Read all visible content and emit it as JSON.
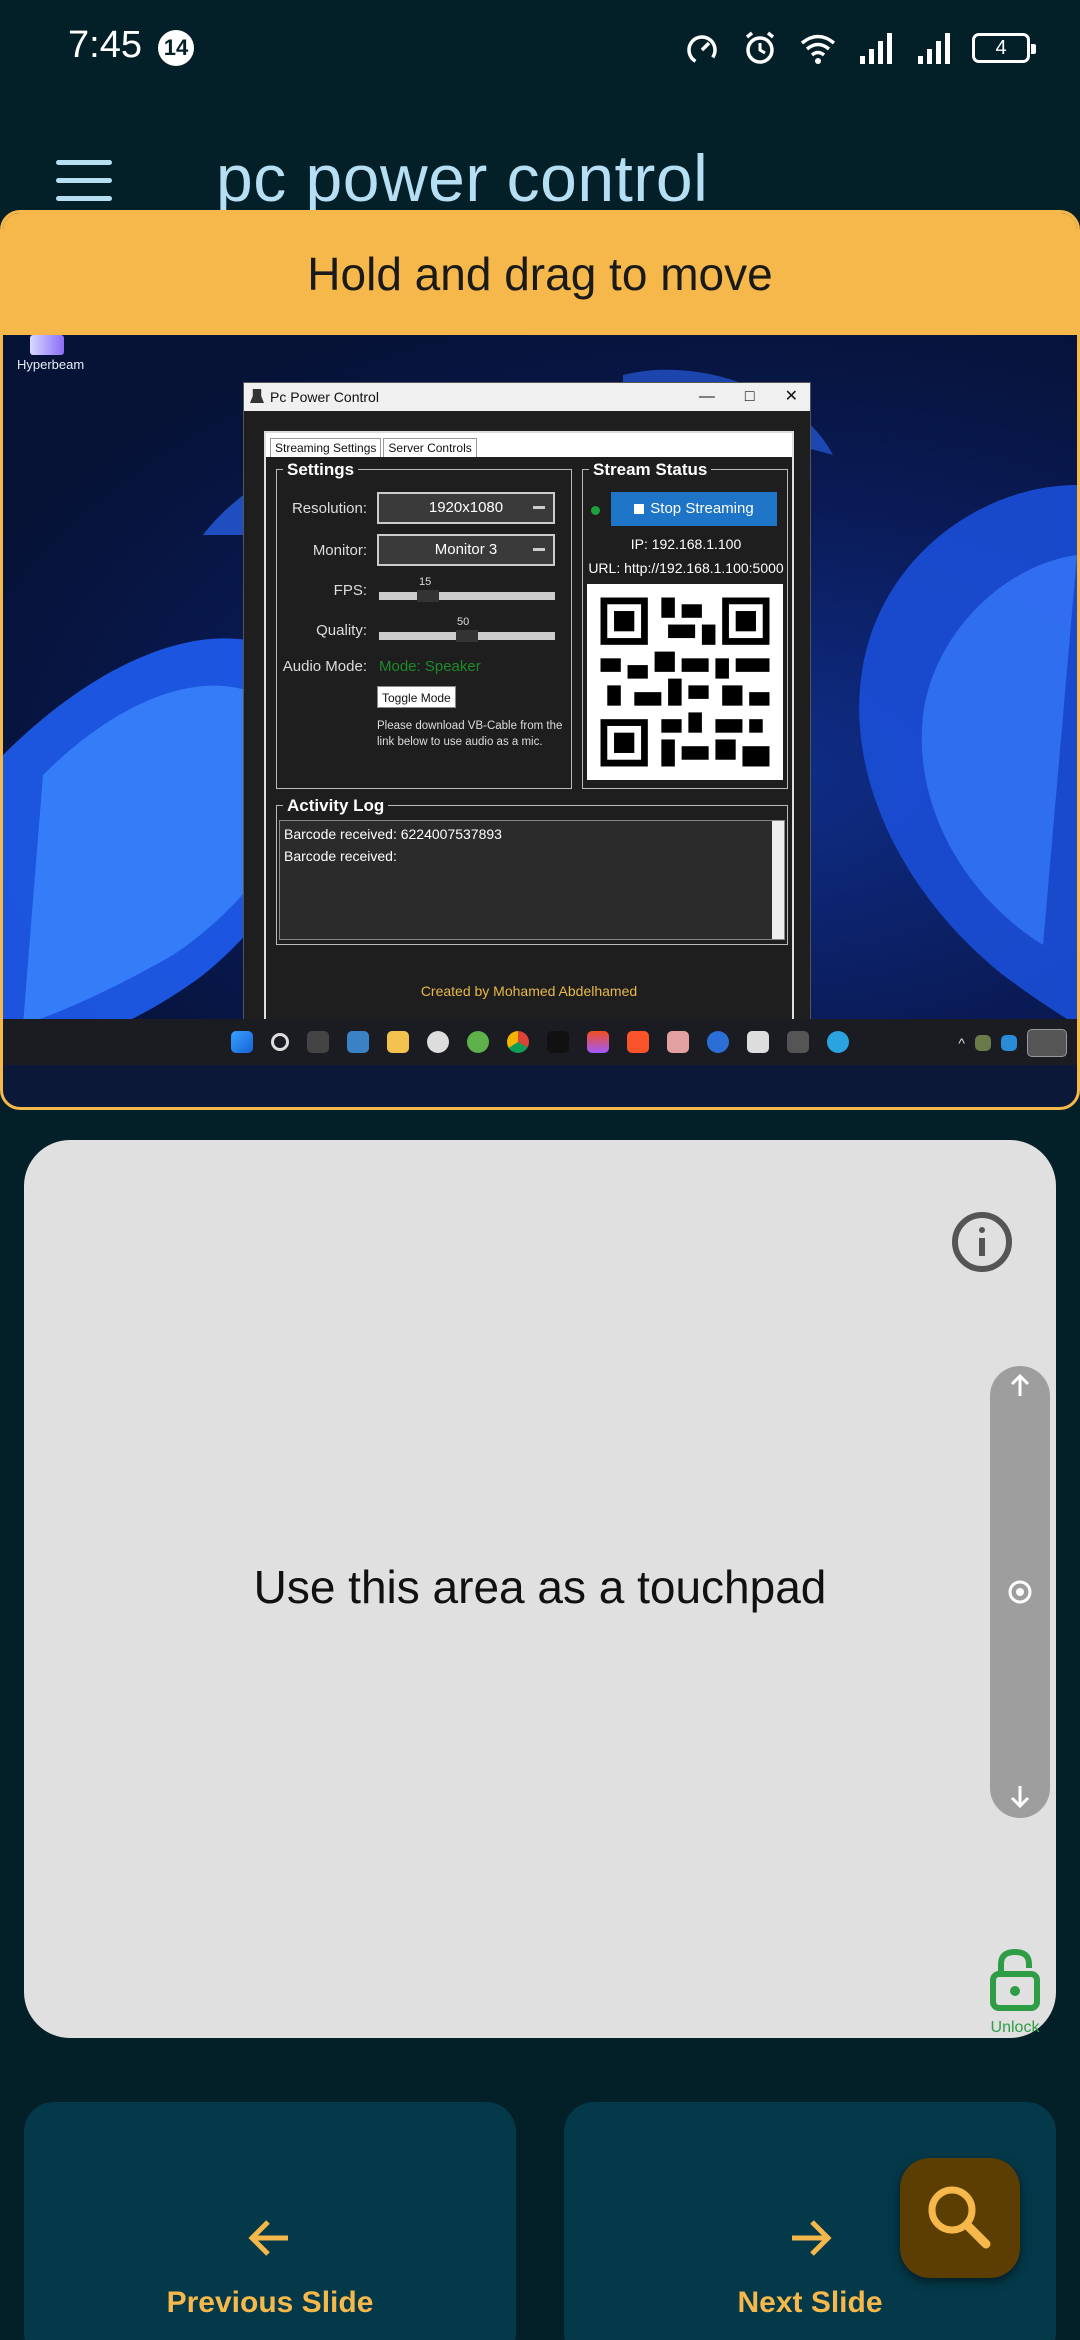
{
  "status_bar": {
    "time": "7:45",
    "notification_count": "14",
    "battery": "4"
  },
  "app_bar": {
    "title": "pc power control"
  },
  "stream": {
    "drag_hint": "Hold and drag to move",
    "desktop_icon_label": "Hyperbeam",
    "window": {
      "title": "Pc Power Control",
      "tabs": [
        "Streaming Settings",
        "Server Controls"
      ],
      "settings": {
        "group_title": "Settings",
        "resolution_label": "Resolution:",
        "resolution_value": "1920x1080",
        "monitor_label": "Monitor:",
        "monitor_value": "Monitor 3",
        "fps_label": "FPS:",
        "fps_value": "15",
        "quality_label": "Quality:",
        "quality_value": "50",
        "audio_mode_label": "Audio Mode:",
        "audio_mode_value": "Mode: Speaker",
        "toggle_mode_button": "Toggle Mode",
        "note_line1": "Please download VB-Cable from the",
        "note_line2": "link below to use audio as a mic."
      },
      "stream_status": {
        "group_title": "Stream Status",
        "stop_button": "Stop Streaming",
        "ip": "IP: 192.168.1.100",
        "url": "URL: http://192.168.1.100:5000"
      },
      "activity_log": {
        "group_title": "Activity Log",
        "lines": [
          "Barcode received: 6224007537893",
          "Barcode received:"
        ]
      },
      "credit": "Created by Mohamed Abdelhamed"
    }
  },
  "touchpad": {
    "hint": "Use this area as a touchpad",
    "unlock_label": "Unlock"
  },
  "nav": {
    "previous_label": "Previous Slide",
    "next_label": "Next Slide"
  },
  "colors": {
    "background": "#032029",
    "accent": "#f6b84a",
    "title": "#b6dff3",
    "touchpad": "#e0e0e0",
    "fab": "#5c3e03",
    "unlock": "#2e9d45"
  },
  "icons": {
    "menu": "hamburger-icon",
    "info": "info-icon",
    "scroll_up": "arrow-up-icon",
    "scroll_center": "touch-icon",
    "scroll_down": "arrow-down-icon",
    "unlock": "unlock-icon",
    "previous": "arrow-left-icon",
    "next": "arrow-right-icon",
    "fab": "search-icon"
  }
}
